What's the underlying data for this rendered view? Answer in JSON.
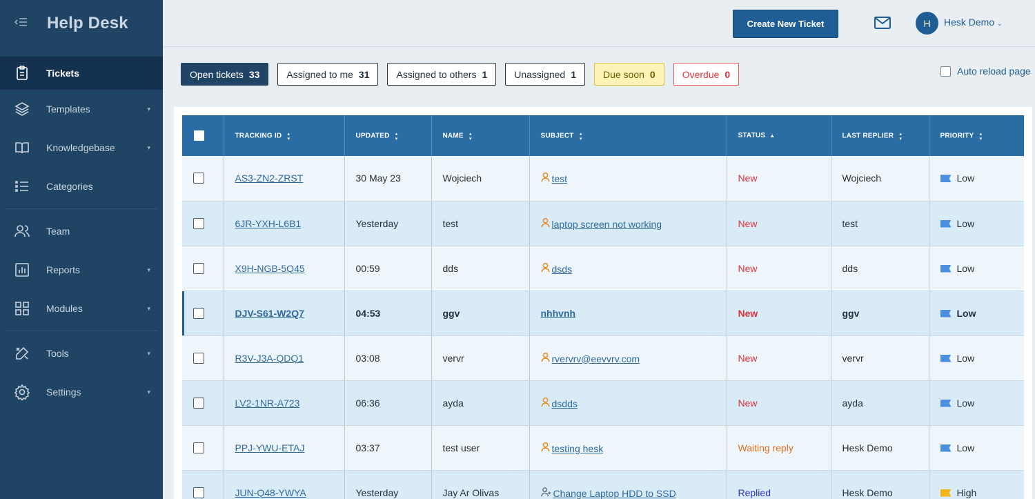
{
  "app": {
    "title": "Help Desk"
  },
  "sidebar": {
    "items": [
      {
        "label": "Tickets",
        "icon": "clipboard-icon",
        "active": true,
        "caret": false
      },
      {
        "label": "Templates",
        "icon": "layers-icon",
        "active": false,
        "caret": true
      },
      {
        "label": "Knowledgebase",
        "icon": "book-icon",
        "active": false,
        "caret": true
      },
      {
        "label": "Categories",
        "icon": "list-icon",
        "active": false,
        "caret": false
      },
      {
        "label": "Team",
        "icon": "users-icon",
        "active": false,
        "caret": false
      },
      {
        "label": "Reports",
        "icon": "chart-icon",
        "active": false,
        "caret": true
      },
      {
        "label": "Modules",
        "icon": "grid-icon",
        "active": false,
        "caret": true
      },
      {
        "label": "Tools",
        "icon": "tools-icon",
        "active": false,
        "caret": true
      },
      {
        "label": "Settings",
        "icon": "gear-icon",
        "active": false,
        "caret": true
      }
    ]
  },
  "header": {
    "create_label": "Create New Ticket",
    "avatar_letter": "H",
    "user_name": "Hesk Demo"
  },
  "filters": [
    {
      "label": "Open tickets",
      "count": "33",
      "style": "active"
    },
    {
      "label": "Assigned to me",
      "count": "31",
      "style": ""
    },
    {
      "label": "Assigned to others",
      "count": "1",
      "style": ""
    },
    {
      "label": "Unassigned",
      "count": "1",
      "style": ""
    },
    {
      "label": "Due soon",
      "count": "0",
      "style": "due"
    },
    {
      "label": "Overdue",
      "count": "0",
      "style": "overdue"
    }
  ],
  "auto_reload_label": "Auto reload page",
  "table": {
    "columns": [
      "TRACKING ID",
      "UPDATED",
      "NAME",
      "SUBJECT",
      "STATUS",
      "LAST REPLIER",
      "PRIORITY"
    ],
    "rows": [
      {
        "id": "AS3-ZN2-ZRST",
        "updated": "30 May 23",
        "name": "Wojciech",
        "subject": "test",
        "subject_icon": "user",
        "status": "New",
        "status_type": "new",
        "replier": "Wojciech",
        "priority": "Low",
        "bold": false
      },
      {
        "id": "6JR-YXH-L6B1",
        "updated": "Yesterday",
        "name": "test",
        "subject": "laptop screen not working",
        "subject_icon": "user",
        "status": "New",
        "status_type": "new",
        "replier": "test",
        "priority": "Low",
        "bold": false
      },
      {
        "id": "X9H-NGB-5Q45",
        "updated": "00:59",
        "name": "dds",
        "subject": "dsds",
        "subject_icon": "user",
        "status": "New",
        "status_type": "new",
        "replier": "dds",
        "priority": "Low",
        "bold": false
      },
      {
        "id": "DJV-S61-W2Q7",
        "updated": "04:53",
        "name": "ggv",
        "subject": "nhhvnh",
        "subject_icon": "",
        "status": "New",
        "status_type": "new",
        "replier": "ggv",
        "priority": "Low",
        "bold": true
      },
      {
        "id": "R3V-J3A-QDQ1",
        "updated": "03:08",
        "name": "vervr",
        "subject": "rvervrv@eevvrv.com",
        "subject_icon": "user",
        "status": "New",
        "status_type": "new",
        "replier": "vervr",
        "priority": "Low",
        "bold": false
      },
      {
        "id": "LV2-1NR-A723",
        "updated": "06:36",
        "name": "ayda",
        "subject": "dsdds",
        "subject_icon": "user",
        "status": "New",
        "status_type": "new",
        "replier": "ayda",
        "priority": "Low",
        "bold": false
      },
      {
        "id": "PPJ-YWU-ETAJ",
        "updated": "03:37",
        "name": "test user",
        "subject": "testing hesk",
        "subject_icon": "user",
        "status": "Waiting reply",
        "status_type": "wait",
        "replier": "Hesk Demo",
        "priority": "Low",
        "bold": false
      },
      {
        "id": "JUN-Q48-YWYA",
        "updated": "Yesterday",
        "name": "Jay Ar Olivas",
        "subject": "Change Laptop HDD to SSD",
        "subject_icon": "user-plus",
        "status": "Replied",
        "status_type": "rep",
        "replier": "Hesk Demo",
        "priority": "High",
        "bold": false
      }
    ]
  }
}
